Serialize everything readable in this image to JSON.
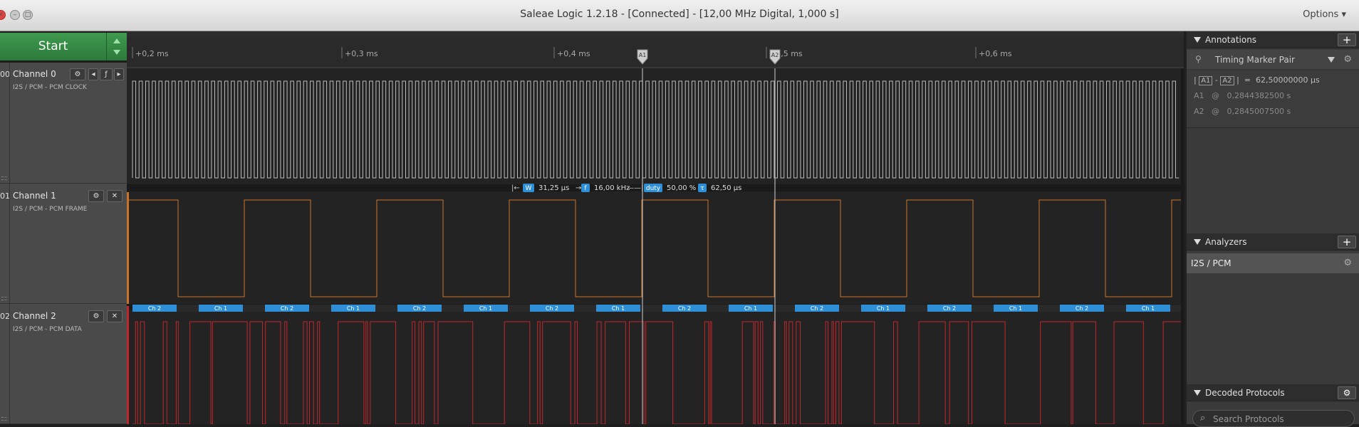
{
  "window": {
    "title": "Saleae Logic 1.2.18 - [Connected] - [12,00 MHz Digital, 1,000 s]",
    "options_label": "Options",
    "traffic_lights": [
      "×",
      "–",
      "□"
    ]
  },
  "controls": {
    "start_label": "Start"
  },
  "timeline": {
    "ticks": [
      "+0,2 ms",
      "+0,3 ms",
      "+0,4 ms",
      "+0,5 ms",
      "+0,6 ms"
    ],
    "markers": [
      "A1",
      "A2"
    ]
  },
  "channels": [
    {
      "num": "00",
      "name": "Channel 0",
      "sub": "I2S / PCM - PCM CLOCK",
      "color": "#bdbdbd"
    },
    {
      "num": "01",
      "name": "Channel 1",
      "sub": "I2S / PCM - PCM FRAME",
      "color": "#c8732a"
    },
    {
      "num": "02",
      "name": "Channel 2",
      "sub": "I2S / PCM - PCM DATA",
      "color": "#c0262b"
    }
  ],
  "measurement": {
    "w_icon": "W",
    "width": "31,25 µs",
    "f_icon": "f",
    "freq": "16,00 kHz",
    "duty_icon": "duty",
    "duty": "50,00 %",
    "t_icon": "τ",
    "period": "62,50 µs"
  },
  "protocol_labels": [
    "Ch 2",
    "Ch 1",
    "Ch 2",
    "Ch 1",
    "Ch 2",
    "Ch 1",
    "Ch 2",
    "Ch 1",
    "Ch 2",
    "Ch 1",
    "Ch 2",
    "Ch 1",
    "Ch 2",
    "Ch 1",
    "Ch 2",
    "Ch 1"
  ],
  "annotations": {
    "header": "Annotations",
    "item": "Timing Marker Pair",
    "diff_a": "A1",
    "diff_b": "A2",
    "diff_value": "62,50000000 µs",
    "a1_label": "A1",
    "a1_value": "0,2844382500 s",
    "a2_label": "A2",
    "a2_value": "0,2845007500 s"
  },
  "analyzers": {
    "header": "Analyzers",
    "item": "I2S / PCM"
  },
  "decoded": {
    "header": "Decoded Protocols",
    "search_placeholder": "Search Protocols"
  },
  "colors": {
    "clock": "#bdbdbd",
    "frame": "#c8732a",
    "data": "#c0262b",
    "proto": "#2f8fd6",
    "start": "#3a8f48"
  }
}
